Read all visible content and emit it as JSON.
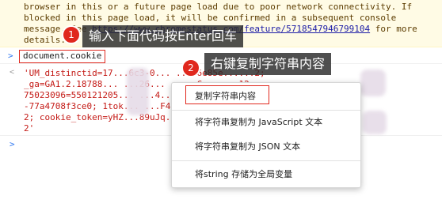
{
  "warning": {
    "lines": [
      "browser in this or a future page load due to poor network connectivity. If",
      "blocked in this page load, it will be confirmed in a subsequent console",
      "message. See https://www.chromestatus.com/feature/5718547946799104 for more",
      "details."
    ],
    "link_text": "https://www.chromestatus.com/feature/5718547946799104"
  },
  "console": {
    "prompt_glyph": ">",
    "command": "document.cookie",
    "result_lines": [
      "'UM_distinctid=17...6c3-0... ...f6e85e......2;",
      "_ga=GA1.2.18788... ...26... ...; C... ...12",
      "75023096=550121205... ...4... ...41-... ...0f",
      "-77a4708f3ce0; 1tok... ...F4In... ...tuid... ...43",
      "2; cookie_token=yHZ...89uJq... ...t_id... ...3",
      "2'"
    ],
    "next_prompt_glyph": ">"
  },
  "callouts": [
    {
      "badge": "1",
      "text": "输入下面代码按Enter回车"
    },
    {
      "badge": "2",
      "text": "右键复制字符串内容"
    }
  ],
  "context_menu": {
    "items": [
      "复制字符串内容",
      "将字符串复制为 JavaScript 文本",
      "将字符串复制为 JSON 文本",
      "将string 存储为全局变量"
    ]
  },
  "colors": {
    "warning_bg": "#fffbe5",
    "highlight_red": "#e0281e",
    "string_red": "#c41a16",
    "prompt_blue": "#367cf1"
  }
}
